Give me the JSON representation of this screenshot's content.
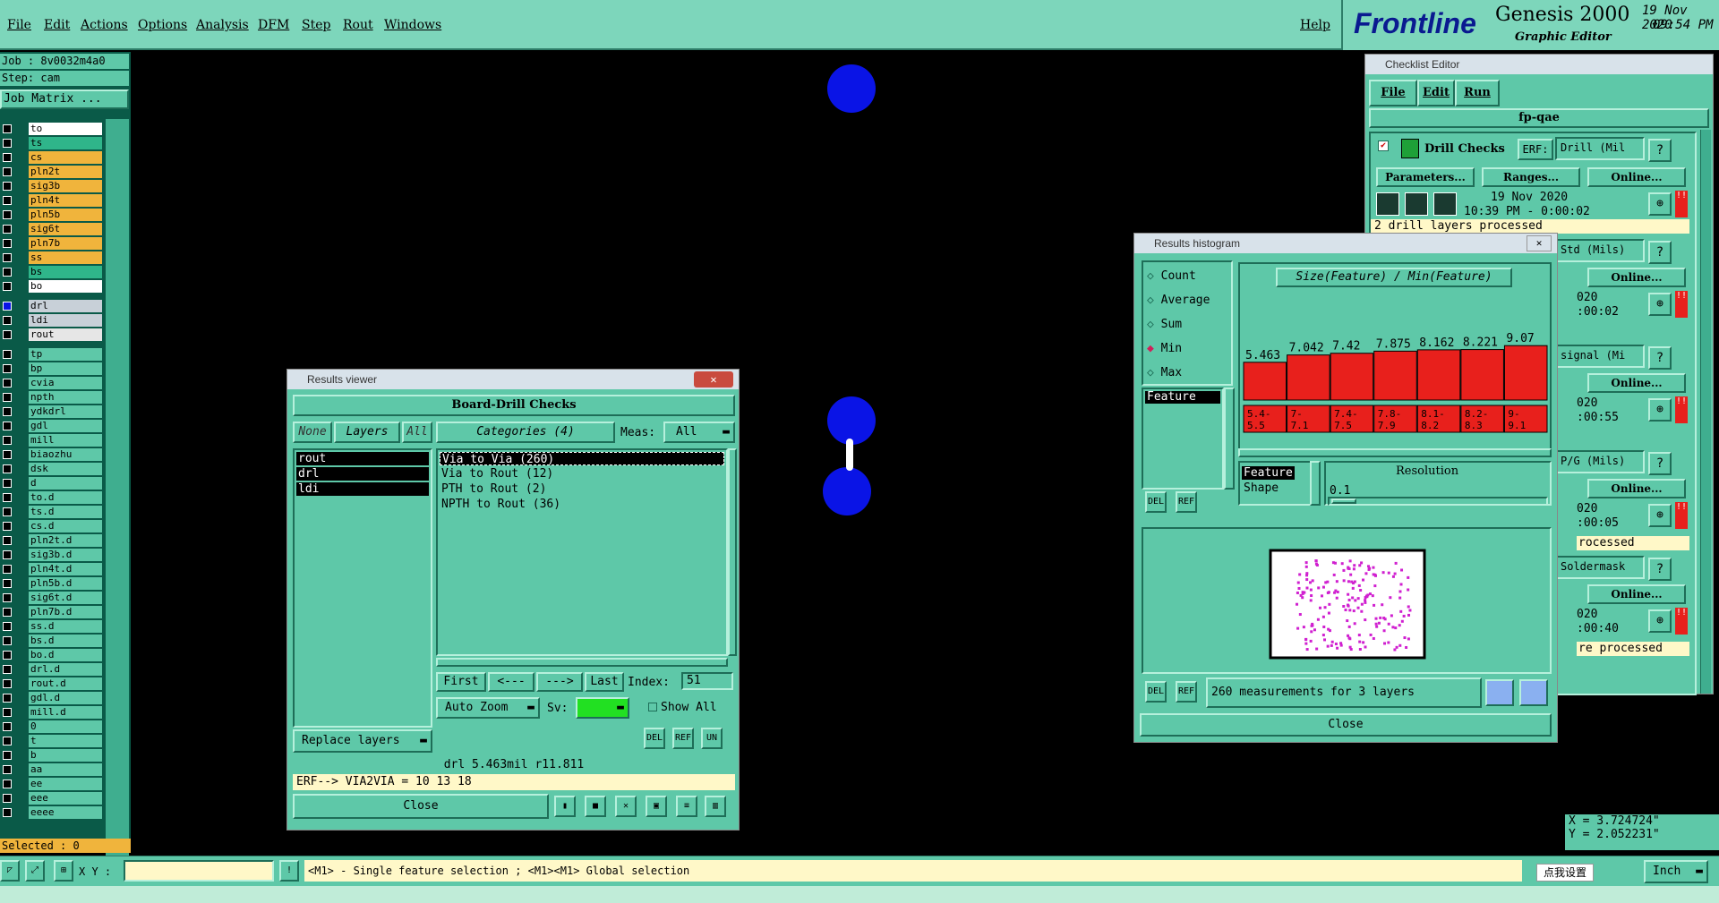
{
  "menu": {
    "items": [
      "File",
      "Edit",
      "Actions",
      "Options",
      "Analysis",
      "DFM",
      "Step",
      "Rout",
      "Windows"
    ],
    "help": "Help"
  },
  "brand": {
    "logo": "Frontline",
    "product": "Genesis 2000",
    "subtitle": "Graphic Editor",
    "date": "19 Nov 2020",
    "time": "09:54 PM"
  },
  "left_panel": {
    "job": "Job : 8v0032m4a0",
    "step": "Step: cam",
    "job_matrix": "Job Matrix ...",
    "layers": [
      {
        "name": "to",
        "color": "#ffffff"
      },
      {
        "name": "ts",
        "color": "#2fb58a"
      },
      {
        "name": "cs",
        "color": "#f0b43c"
      },
      {
        "name": "pln2t",
        "color": "#f0b43c"
      },
      {
        "name": "sig3b",
        "color": "#f0b43c"
      },
      {
        "name": "pln4t",
        "color": "#f0b43c"
      },
      {
        "name": "pln5b",
        "color": "#f0b43c"
      },
      {
        "name": "sig6t",
        "color": "#f0b43c"
      },
      {
        "name": "pln7b",
        "color": "#f0b43c"
      },
      {
        "name": "ss",
        "color": "#f0b43c"
      },
      {
        "name": "bs",
        "color": "#2fb58a"
      },
      {
        "name": "bo",
        "color": "#ffffff"
      },
      {
        "name": "drl",
        "color": "#c8d0d8"
      },
      {
        "name": "ldi",
        "color": "#c8d0d8"
      },
      {
        "name": "rout",
        "color": "#e6e6e6"
      },
      {
        "name": "tp",
        "color": "#5ec8a8"
      },
      {
        "name": "bp",
        "color": "#5ec8a8"
      },
      {
        "name": "cvia",
        "color": "#5ec8a8"
      },
      {
        "name": "npth",
        "color": "#5ec8a8"
      },
      {
        "name": "ydkdrl",
        "color": "#5ec8a8"
      },
      {
        "name": "gdl",
        "color": "#5ec8a8"
      },
      {
        "name": "mill",
        "color": "#5ec8a8"
      },
      {
        "name": "biaozhu",
        "color": "#5ec8a8"
      },
      {
        "name": "dsk",
        "color": "#5ec8a8"
      },
      {
        "name": "d",
        "color": "#5ec8a8"
      },
      {
        "name": "to.d",
        "color": "#5ec8a8"
      },
      {
        "name": "ts.d",
        "color": "#5ec8a8"
      },
      {
        "name": "cs.d",
        "color": "#5ec8a8"
      },
      {
        "name": "pln2t.d",
        "color": "#5ec8a8"
      },
      {
        "name": "sig3b.d",
        "color": "#5ec8a8"
      },
      {
        "name": "pln4t.d",
        "color": "#5ec8a8"
      },
      {
        "name": "pln5b.d",
        "color": "#5ec8a8"
      },
      {
        "name": "sig6t.d",
        "color": "#5ec8a8"
      },
      {
        "name": "pln7b.d",
        "color": "#5ec8a8"
      },
      {
        "name": "ss.d",
        "color": "#5ec8a8"
      },
      {
        "name": "bs.d",
        "color": "#5ec8a8"
      },
      {
        "name": "bo.d",
        "color": "#5ec8a8"
      },
      {
        "name": "drl.d",
        "color": "#5ec8a8"
      },
      {
        "name": "rout.d",
        "color": "#5ec8a8"
      },
      {
        "name": "gdl.d",
        "color": "#5ec8a8"
      },
      {
        "name": "mill.d",
        "color": "#5ec8a8"
      },
      {
        "name": "0",
        "color": "#5ec8a8"
      },
      {
        "name": "t",
        "color": "#5ec8a8"
      },
      {
        "name": "b",
        "color": "#5ec8a8"
      },
      {
        "name": "aa",
        "color": "#5ec8a8"
      },
      {
        "name": "ee",
        "color": "#5ec8a8"
      },
      {
        "name": "eee",
        "color": "#5ec8a8"
      },
      {
        "name": "eeee",
        "color": "#5ec8a8"
      }
    ],
    "selected": "Selected : 0"
  },
  "results_viewer": {
    "title": "Results viewer",
    "header": "Board-Drill Checks",
    "none_btn": "None",
    "layers_btn": "Layers",
    "all_btn": "All",
    "categories_btn": "Categories (4)",
    "meas_label": "Meas:",
    "meas_value": "All",
    "layer_list": [
      "rout",
      "drl",
      "ldi"
    ],
    "categories": [
      "Via to Via  (260)",
      "Via to Rout  (12)",
      "PTH to Rout  (2)",
      "NPTH to Rout  (36)"
    ],
    "first_btn": "First",
    "prev_btn": "<---",
    "next_btn": "--->",
    "last_btn": "Last",
    "index_label": "Index:",
    "index_value": "51",
    "auto_zoom": "Auto Zoom",
    "sv_label": "Sv:",
    "show_all": "Show All",
    "replace_layers": "Replace layers",
    "status_line": "drl 5.463mil  r11.811",
    "erf_line": "ERF--> VIA2VIA = 10 13 18",
    "close": "Close"
  },
  "histogram": {
    "title": "Results histogram",
    "radio_options": [
      "Count",
      "Average",
      "Sum",
      "Min",
      "Max"
    ],
    "selected_option": "Min",
    "feature_item": "Feature",
    "chart_title": "Size(Feature) / Min(Feature)",
    "resolution_label": "Resolution",
    "resolution_value": "0.1",
    "feature_shape": [
      "Feature",
      "Shape"
    ],
    "measurements": "260 measurements for 3 layers",
    "close": "Close",
    "del": "DEL",
    "ref": "REF"
  },
  "chart_data": {
    "type": "bar",
    "title": "Size(Feature) / Min(Feature)",
    "categories": [
      "5.4-5.5",
      "7-7.1",
      "7.4-7.5",
      "7.8-7.9",
      "8.1-8.2",
      "8.2-8.3",
      "9-9.1"
    ],
    "values": [
      5.463,
      7.042,
      7.42,
      7.875,
      8.162,
      8.221,
      9.07
    ],
    "value_labels": [
      "5.463",
      "7.042",
      "7.42",
      "7.875",
      "8.162",
      "8.221",
      "9.07"
    ],
    "category_labels": [
      [
        "5.4-",
        "5.5"
      ],
      [
        "7-",
        "7.1"
      ],
      [
        "7.4-",
        "7.5"
      ],
      [
        "7.8-",
        "7.9"
      ],
      [
        "8.1-",
        "8.2"
      ],
      [
        "8.2-",
        "8.3"
      ],
      [
        "9-",
        "9.1"
      ]
    ],
    "bar_color": "#e8201c"
  },
  "checklist": {
    "title": "Checklist Editor",
    "menu": [
      "File",
      "Edit",
      "Run"
    ],
    "name": "fp-qae",
    "check_name": "Drill Checks",
    "erf_label": "ERF:",
    "erf_values": [
      "Drill (Mil",
      "Std (Mils)",
      "signal (Mi",
      "P/G (Mils)",
      "Soldermask"
    ],
    "parameters_btn": "Parameters...",
    "ranges_btn": "Ranges...",
    "online_btn": "Online...",
    "date1": "19 Nov 2020",
    "time1": "10:39 PM - 0:00:02",
    "processed1": "2 drill layers processed",
    "row_times": [
      "020",
      ":00:02",
      "020",
      ":00:55",
      "020",
      ":00:05",
      "020",
      ":00:40"
    ],
    "processed_partial": [
      "rocessed",
      "re processed"
    ]
  },
  "coords": {
    "x": "X = 3.724724\"",
    "y": "Y = 2.052231\""
  },
  "statusbar": {
    "xy_label": "X Y :",
    "message": "<M1> - Single feature selection ; <M1><M1> Global selection",
    "units": "Inch",
    "tooltip": "点我设置"
  },
  "colors": {
    "canvas": "#000000",
    "panel": "#5ec8a8",
    "pad": "#0a14e6",
    "selection": "#f0b43c"
  }
}
